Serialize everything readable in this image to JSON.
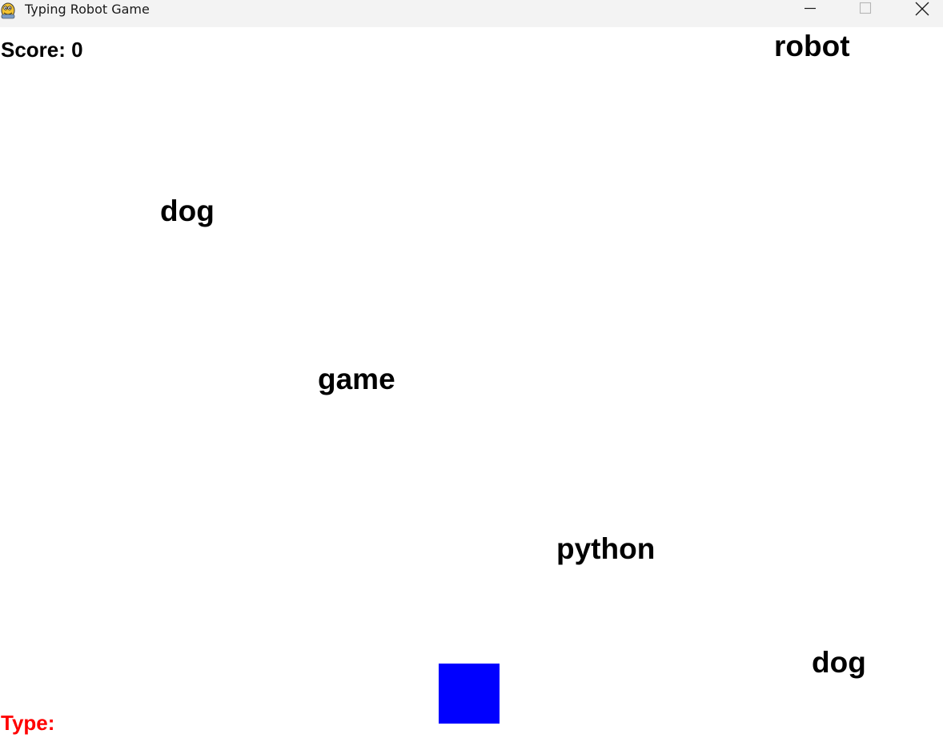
{
  "window": {
    "title": "Typing Robot Game",
    "app_icon": "pygame-snake-icon",
    "controls": {
      "minimize_icon": "minimize-icon",
      "maximize_icon": "maximize-icon",
      "close_icon": "close-icon"
    }
  },
  "hud": {
    "score_label": "Score: 0",
    "type_label": "Type:",
    "typed_text": "",
    "prompt_color": "#ff0000"
  },
  "falling_words": [
    {
      "text": "robot"
    },
    {
      "text": "dog"
    },
    {
      "text": "game"
    },
    {
      "text": "python"
    },
    {
      "text": "dog"
    }
  ],
  "player": {
    "shape": "square",
    "color": "#0000ff"
  }
}
